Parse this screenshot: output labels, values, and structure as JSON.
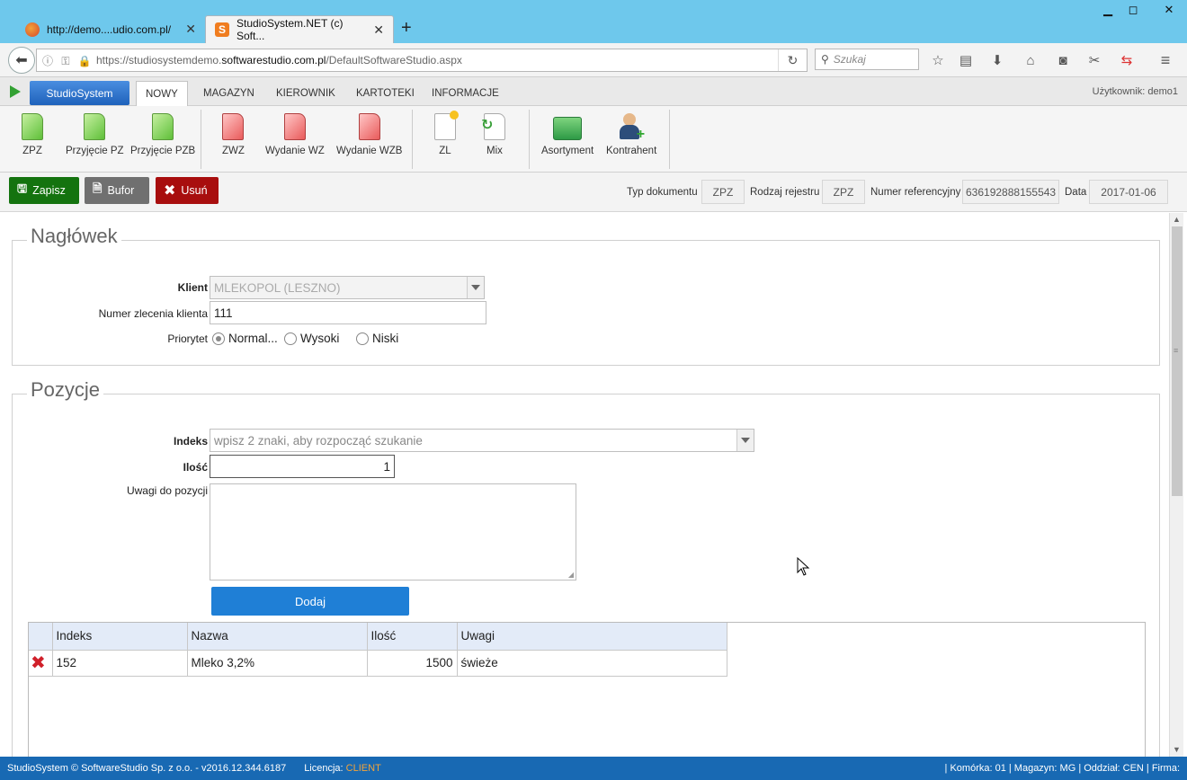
{
  "browser": {
    "tabs": [
      {
        "label": "http://demo....udio.com.pl/",
        "active": false
      },
      {
        "label": "StudioSystem.NET (c) Soft...",
        "active": true
      }
    ],
    "url_prefix": "https://studiosystemdemo.",
    "url_domain": "softwarestudio.com.pl",
    "url_path": "/DefaultSoftwareStudio.aspx",
    "search_placeholder": "Szukaj"
  },
  "appmenu": {
    "brand": "StudioSystem",
    "items": [
      "NOWY",
      "MAGAZYN",
      "KIEROWNIK",
      "KARTOTEKI",
      "INFORMACJE"
    ],
    "active": "NOWY",
    "user": "Użytkownik: demo1"
  },
  "ribbon": {
    "buttons": [
      {
        "label": "ZPZ",
        "icon": "green-document-icon"
      },
      {
        "label": "Przyjęcie PZ",
        "icon": "green-document-icon"
      },
      {
        "label": "Przyjęcie PZB",
        "icon": "green-document-icon"
      },
      {
        "label": "ZWZ",
        "icon": "red-document-icon"
      },
      {
        "label": "Wydanie WZ",
        "icon": "red-document-icon"
      },
      {
        "label": "Wydanie WZB",
        "icon": "red-document-icon"
      },
      {
        "label": "ZL",
        "icon": "new-document-icon"
      },
      {
        "label": "Mix",
        "icon": "mix-document-icon"
      },
      {
        "label": "Asortyment",
        "icon": "assortment-box-icon"
      },
      {
        "label": "Kontrahent",
        "icon": "contractor-icon"
      }
    ]
  },
  "actions": {
    "save": "Zapisz",
    "buffer": "Bufor",
    "delete": "Usuń"
  },
  "docmeta": {
    "doc_type_label": "Typ dokumentu",
    "doc_type": "ZPZ",
    "register_label": "Rodzaj rejestru",
    "register": "ZPZ",
    "ref_label": "Numer referencyjny",
    "ref": "636192888155543",
    "date_label": "Data",
    "date": "2017-01-06"
  },
  "header_panel": {
    "legend": "Nagłówek",
    "client_label": "Klient",
    "client_value": "MLEKOPOL (LESZNO)",
    "order_label": "Numer zlecenia klienta",
    "order_value": "111",
    "priority_label": "Priorytet",
    "priorities": [
      "Normal...",
      "Wysoki",
      "Niski"
    ],
    "priority_selected": 0
  },
  "positions_panel": {
    "legend": "Pozycje",
    "index_label": "Indeks",
    "index_placeholder": "wpisz 2 znaki, aby rozpocząć szukanie",
    "qty_label": "Ilość",
    "qty_value": "1",
    "notes_label": "Uwagi do pozycji",
    "add_button": "Dodaj",
    "columns": [
      "Indeks",
      "Nazwa",
      "Ilość",
      "Uwagi"
    ],
    "rows": [
      {
        "indeks": "152",
        "nazwa": "Mleko 3,2%",
        "ilosc": "1500",
        "uwagi": "świeże"
      }
    ]
  },
  "statusbar": {
    "copyright": "StudioSystem © SoftwareStudio Sp. z o.o. - v2016.12.344.6187",
    "license_label": "Licencja:",
    "license_value": "CLIENT",
    "context": "| Komórka: 01 | Magazyn: MG | Oddział: CEN | Firma:"
  }
}
